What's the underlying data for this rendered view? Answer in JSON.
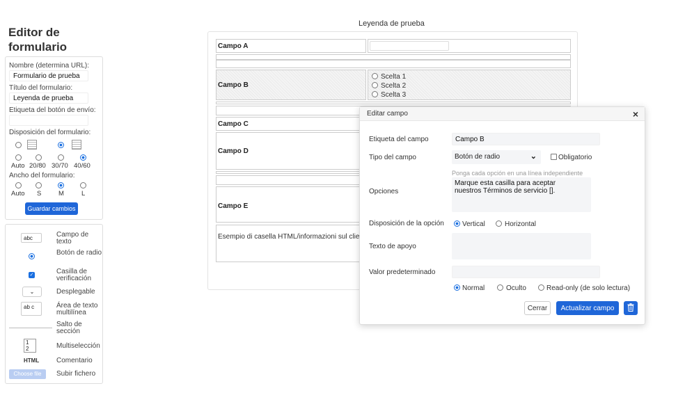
{
  "sidebar": {
    "title": "Editor de formulario",
    "name_label": "Nombre (determina URL):",
    "name_value": "Formulario de prueba",
    "title_label": "Título del formulario:",
    "title_value": "Leyenda de prueba",
    "submit_label": "Etiqueta del botón de envío:",
    "submit_value": "",
    "layout_label": "Disposición del formulario:",
    "split_options": [
      "Auto",
      "20/80",
      "30/70",
      "40/60"
    ],
    "width_label": "Ancho del formulario:",
    "width_options": [
      "Auto",
      "S",
      "M",
      "L"
    ],
    "save_label": "Guardar cambios"
  },
  "palette": {
    "items": [
      {
        "label": "Campo de texto",
        "icon": "text-field-icon",
        "sample": "abc"
      },
      {
        "label": "Botón de radio",
        "icon": "radio-icon"
      },
      {
        "label": "Casilla de verificación",
        "icon": "checkbox-icon"
      },
      {
        "label": "Desplegable",
        "icon": "dropdown-icon"
      },
      {
        "label": "Área de texto multilínea",
        "icon": "textarea-icon",
        "sample": "ab c"
      },
      {
        "label": "Salto de sección",
        "icon": "section-break-icon"
      },
      {
        "label": "Multiselección",
        "icon": "multiselect-icon",
        "sample1": "1",
        "sample2": "2"
      },
      {
        "label": "Comentario",
        "icon": "html-icon",
        "sample": "HTML"
      },
      {
        "label": "Subir fichero",
        "icon": "file-upload-icon",
        "sample": "Choose file"
      }
    ]
  },
  "form": {
    "legend": "Leyenda de prueba",
    "field_a": "Campo A",
    "field_b": "Campo B",
    "field_b_options": [
      "Scelta 1",
      "Scelta 2",
      "Scelta 3"
    ],
    "field_c": "Campo C",
    "field_d": "Campo D",
    "field_e": "Campo E",
    "html_sample": "Esempio di casella HTML/informazioni sul clier"
  },
  "modal": {
    "title": "Editar campo",
    "close": "×",
    "label_label": "Etiqueta del campo",
    "label_value": "Campo B",
    "type_label": "Tipo del campo",
    "type_value": "Botón de radio",
    "required_label": "Obligatorio",
    "options_hint": "Ponga cada opción en una línea independiente",
    "options_label": "Opciones",
    "options_value": "Marque esta casilla para aceptar\nnuestros Términos de servicio [].",
    "layout_label": "Disposición de la opción",
    "layout_vertical": "Vertical",
    "layout_horizontal": "Horizontal",
    "help_label": "Texto de apoyo",
    "help_value": "",
    "default_label": "Valor predeterminado",
    "default_value": "",
    "visibility_normal": "Normal",
    "visibility_hidden": "Oculto",
    "visibility_readonly": "Read-only (de solo lectura)",
    "cancel_label": "Cerrar",
    "update_label": "Actualizar campo"
  },
  "colors": {
    "accent": "#1f66d8"
  }
}
